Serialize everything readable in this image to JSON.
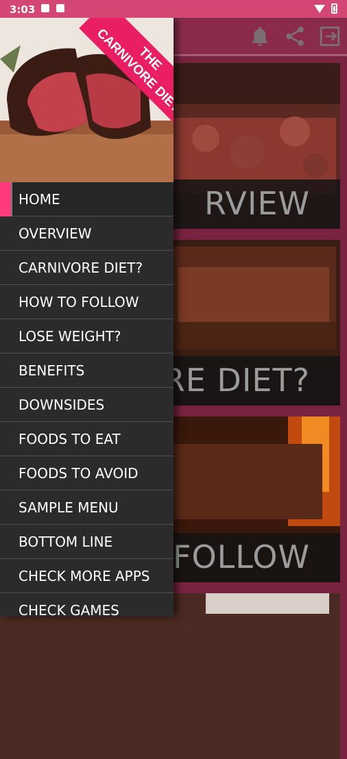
{
  "status_bar": {
    "time": "3:03"
  },
  "drawer": {
    "banner_line1": "THE",
    "banner_line2": "CARNIVORE DIET",
    "items": [
      {
        "label": "HOME"
      },
      {
        "label": "OVERVIEW"
      },
      {
        "label": "CARNIVORE DIET?"
      },
      {
        "label": "HOW TO FOLLOW"
      },
      {
        "label": "LOSE WEIGHT?"
      },
      {
        "label": "BENEFITS"
      },
      {
        "label": "DOWNSIDES"
      },
      {
        "label": "FOODS TO EAT"
      },
      {
        "label": "FOODS TO AVOID"
      },
      {
        "label": "SAMPLE MENU"
      },
      {
        "label": "BOTTOM LINE"
      },
      {
        "label": "CHECK MORE APPS"
      },
      {
        "label": "CHECK GAMES"
      }
    ]
  },
  "cards": [
    {
      "caption": "RVIEW"
    },
    {
      "caption": "ORE DIET?"
    },
    {
      "caption": "FOLLOW"
    }
  ],
  "appbar": {
    "icons": [
      "bell-icon",
      "share-icon",
      "exit-icon"
    ]
  },
  "colors": {
    "status_bar": "#d44673",
    "app_bar": "#8b2b4c",
    "background": "#7a2340",
    "accent": "#e91e63",
    "drawer": "#2b2b2b"
  }
}
